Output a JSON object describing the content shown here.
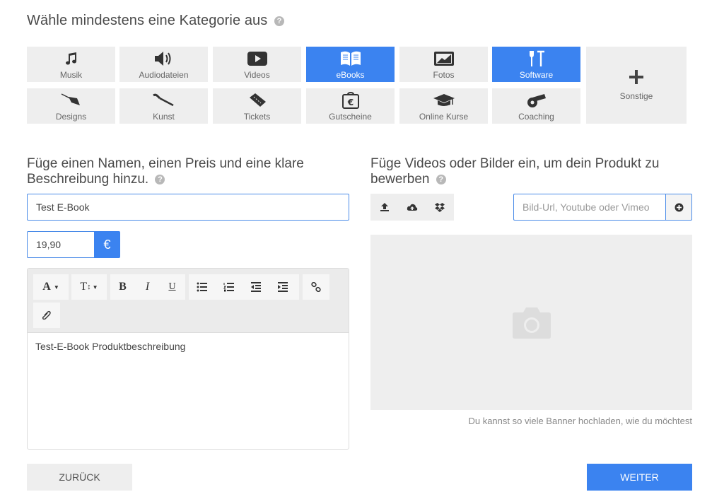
{
  "category_section": {
    "title": "Wähle mindestens eine Kategorie aus",
    "help": "?",
    "categories": [
      {
        "label": "Musik",
        "icon": "music-icon",
        "active": false
      },
      {
        "label": "Audiodateien",
        "icon": "volume-icon",
        "active": false
      },
      {
        "label": "Videos",
        "icon": "video-play-icon",
        "active": false
      },
      {
        "label": "eBooks",
        "icon": "book-icon",
        "active": true
      },
      {
        "label": "Fotos",
        "icon": "photo-icon",
        "active": false
      },
      {
        "label": "Software",
        "icon": "tools-icon",
        "active": true
      },
      {
        "label": "Sonstige",
        "icon": "plus-icon",
        "active": false
      },
      {
        "label": "Designs",
        "icon": "pen-nib-icon",
        "active": false
      },
      {
        "label": "Kunst",
        "icon": "paintbrush-icon",
        "active": false
      },
      {
        "label": "Tickets",
        "icon": "ticket-icon",
        "active": false
      },
      {
        "label": "Gutscheine",
        "icon": "voucher-icon",
        "active": false
      },
      {
        "label": "Online Kurse",
        "icon": "graduation-cap-icon",
        "active": false
      },
      {
        "label": "Coaching",
        "icon": "whistle-icon",
        "active": false
      }
    ],
    "active_color": "#3b83f0"
  },
  "details_section": {
    "title": "Füge einen Namen, einen Preis und eine klare Beschreibung hinzu.",
    "help": "?",
    "name_value": "Test E-Book",
    "price_value": "19,90",
    "currency": "€",
    "editor": {
      "toolbar": {
        "font_label": "A",
        "size_label": "T",
        "bold": "B",
        "italic": "I",
        "underline": "U"
      },
      "content": "Test-E-Book Produktbeschreibung"
    }
  },
  "media_section": {
    "title": "Füge Videos oder Bilder ein, um dein Produkt zu bewerben",
    "help": "?",
    "url_placeholder": "Bild-Url, Youtube oder Vimeo",
    "hint": "Du kannst so viele Banner hochladen, wie du möchtest"
  },
  "footer": {
    "back_label": "ZURÜCK",
    "next_label": "WEITER"
  }
}
